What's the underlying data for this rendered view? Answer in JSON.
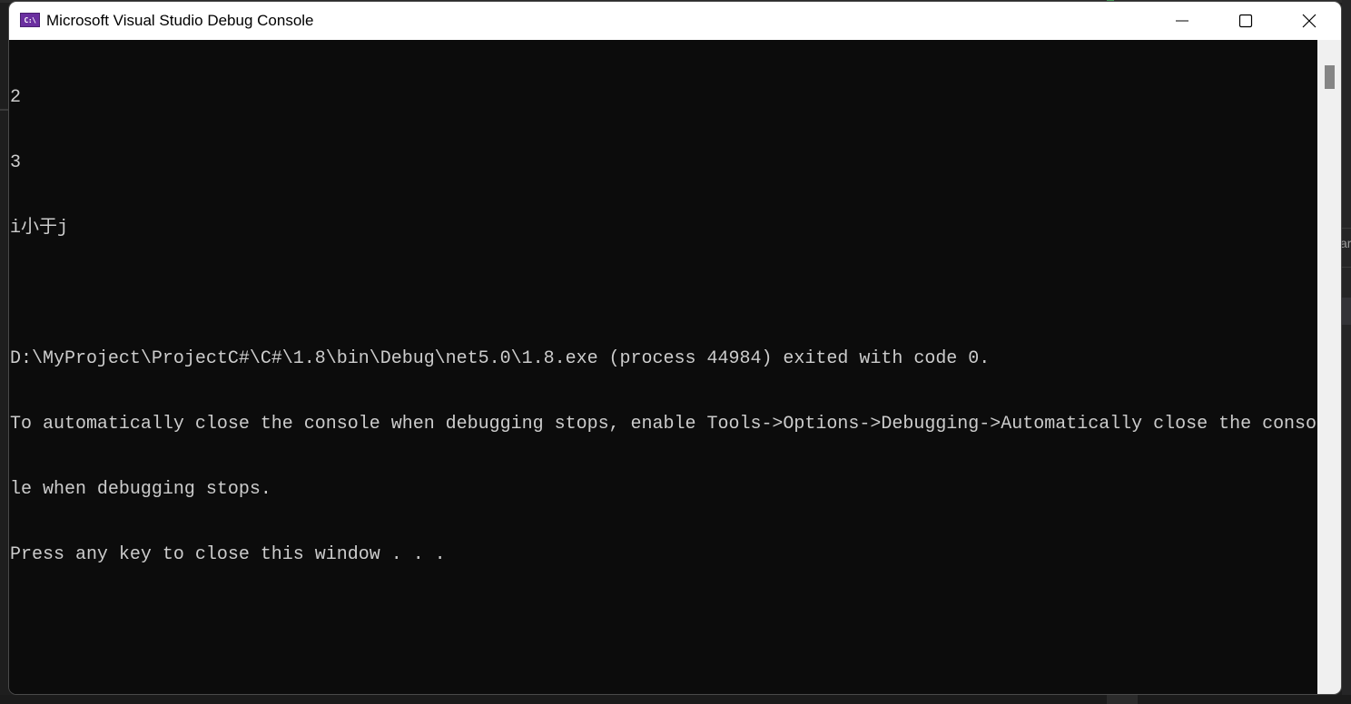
{
  "window": {
    "title": "Microsoft Visual Studio Debug Console",
    "icon": "console-app-icon",
    "icon_text": "C:\\",
    "controls": {
      "minimize": "minimize-icon",
      "maximize": "maximize-icon",
      "close": "close-icon"
    }
  },
  "console": {
    "lines": [
      "2",
      "3",
      "i小于j",
      "",
      "D:\\MyProject\\ProjectC#\\C#\\1.8\\bin\\Debug\\net5.0\\1.8.exe (process 44984) exited with code 0.",
      "To automatically close the console when debugging stops, enable Tools->Options->Debugging->Automatically close the conso",
      "le when debugging stops.",
      "Press any key to close this window . . ."
    ]
  },
  "background": {
    "partial_text": "ar"
  },
  "colors": {
    "console_bg": "#0c0c0c",
    "console_fg": "#cccccc",
    "titlebar_bg": "#ffffff",
    "scrollbar_track": "#f0f0f0",
    "scrollbar_thumb": "#858585",
    "icon_accent": "#6b2fa0"
  }
}
